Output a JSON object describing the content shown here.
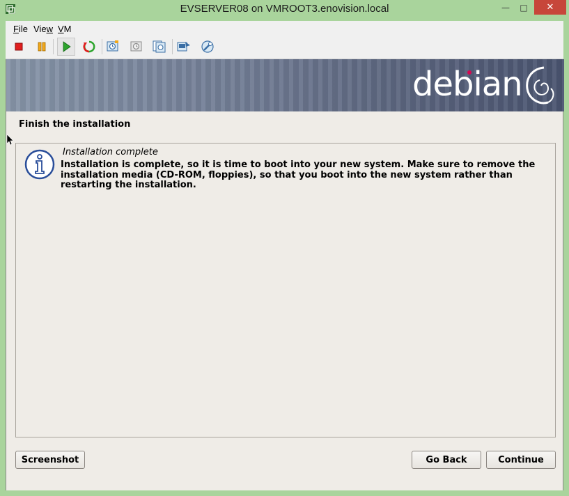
{
  "window": {
    "title": "EVSERVER08 on VMROOT3.enovision.local",
    "minimize_glyph": "—",
    "maximize_glyph": "□",
    "close_glyph": "✕"
  },
  "menu": {
    "file": {
      "accel": "F",
      "rest": "ile"
    },
    "view": {
      "pre": "Vie",
      "accel": "w",
      "rest": ""
    },
    "vm": {
      "accel": "V",
      "rest": "M"
    }
  },
  "toolbar_icons": [
    "stop-icon",
    "pause-icon",
    "start-icon",
    "reset-icon",
    "snapshot-icon",
    "revert-icon",
    "snapshot-manager-icon",
    "ctrl-alt-del-icon",
    "settings-icon"
  ],
  "installer": {
    "logo_text": "debian",
    "step_title": "Finish the installation",
    "panel_heading": "Installation complete",
    "panel_body": "Installation is complete, so it is time to boot into your new system. Make sure to remove the installation media (CD-ROM, floppies), so that you boot into the new system rather than restarting the installation.",
    "buttons": {
      "screenshot": "Screenshot",
      "go_back": "Go Back",
      "continue": "Continue"
    }
  },
  "colors": {
    "window_frame": "#a9d49c",
    "close_button": "#c7463a",
    "debian_red": "#d70751",
    "installer_bg": "#efece7"
  }
}
